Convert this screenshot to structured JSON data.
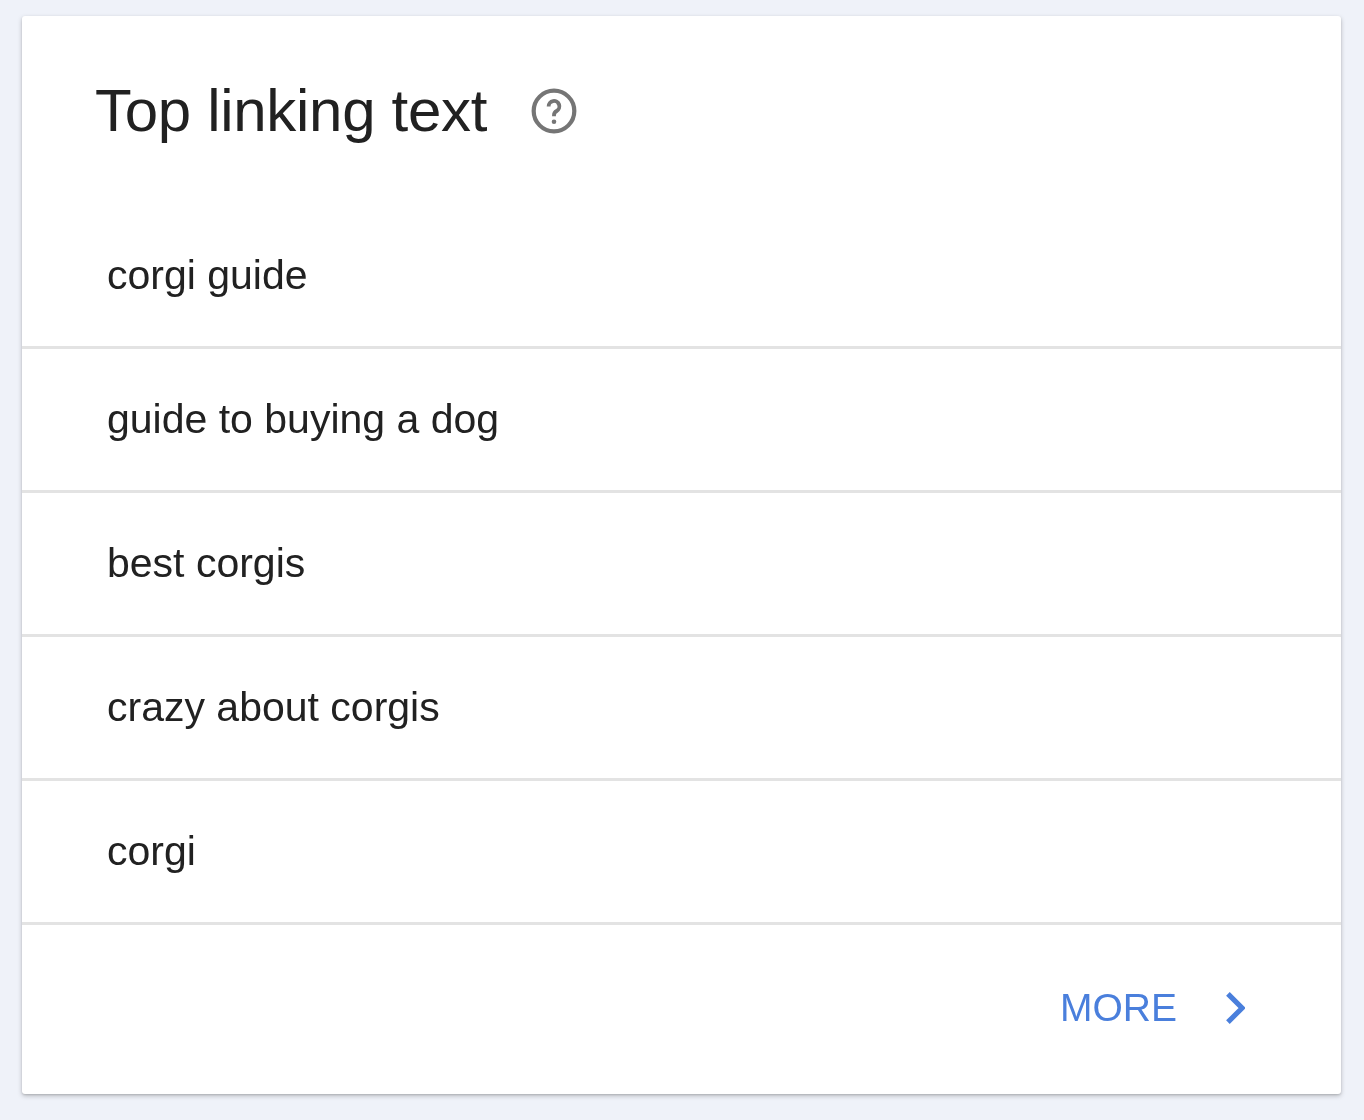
{
  "card": {
    "title": "Top linking text"
  },
  "links": [
    {
      "text": "corgi guide"
    },
    {
      "text": "guide to buying a dog"
    },
    {
      "text": "best corgis"
    },
    {
      "text": "crazy about corgis"
    },
    {
      "text": "corgi"
    }
  ],
  "more_button": {
    "label": "MORE"
  }
}
